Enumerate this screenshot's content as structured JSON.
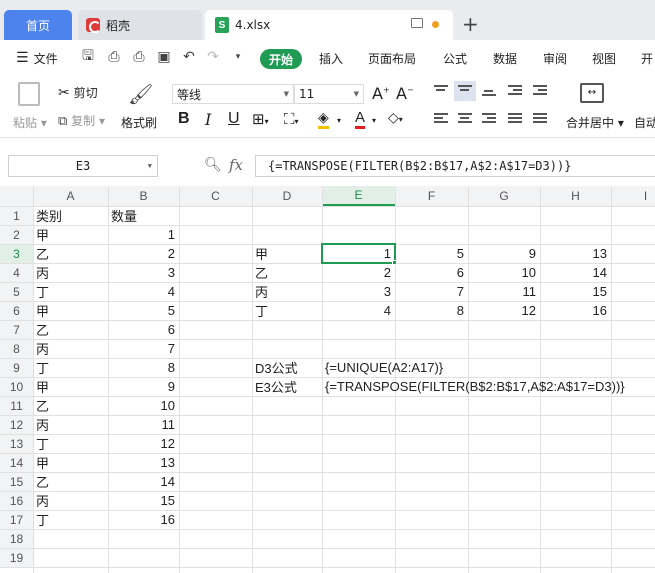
{
  "tabs": {
    "home": "首页",
    "wps": "稻壳",
    "file": "4.xlsx"
  },
  "menu": {
    "file": "文件",
    "items": [
      "开始",
      "插入",
      "页面布局",
      "公式",
      "数据",
      "审阅",
      "视图",
      "开"
    ]
  },
  "ribbon": {
    "paste": "粘贴",
    "cut": "剪切",
    "copy": "复制",
    "format_painter": "格式刷",
    "font_name": "等线",
    "font_size": "11",
    "merge_center": "合并居中",
    "auto": "自动"
  },
  "formula_bar": {
    "cell_ref": "E3",
    "fx": "fx",
    "formula": "{=TRANSPOSE(FILTER(B$2:B$17,A$2:A$17=D3))}"
  },
  "columns": [
    "A",
    "B",
    "C",
    "D",
    "E",
    "F",
    "G",
    "H",
    "I"
  ],
  "rows": [
    "1",
    "2",
    "3",
    "4",
    "5",
    "6",
    "7",
    "8",
    "9",
    "10",
    "11",
    "12",
    "13",
    "14",
    "15",
    "16",
    "17",
    "18",
    "19"
  ],
  "sheet": {
    "a": [
      "类别",
      "甲",
      "乙",
      "丙",
      "丁",
      "甲",
      "乙",
      "丙",
      "丁",
      "甲",
      "乙",
      "丙",
      "丁",
      "甲",
      "乙",
      "丙",
      "丁"
    ],
    "b": [
      "数量",
      "1",
      "2",
      "3",
      "4",
      "5",
      "6",
      "7",
      "8",
      "9",
      "10",
      "11",
      "12",
      "13",
      "14",
      "15",
      "16"
    ],
    "d_list": [
      "甲",
      "乙",
      "丙",
      "丁"
    ],
    "result": [
      [
        "1",
        "5",
        "9",
        "13"
      ],
      [
        "2",
        "6",
        "10",
        "14"
      ],
      [
        "3",
        "7",
        "11",
        "15"
      ],
      [
        "4",
        "8",
        "12",
        "16"
      ]
    ],
    "d3_label": "D3公式",
    "d3_formula": "{=UNIQUE(A2:A17)}",
    "e3_label": "E3公式",
    "e3_formula": "{=TRANSPOSE(FILTER(B$2:B$17,A$2:A$17=D3))}"
  }
}
